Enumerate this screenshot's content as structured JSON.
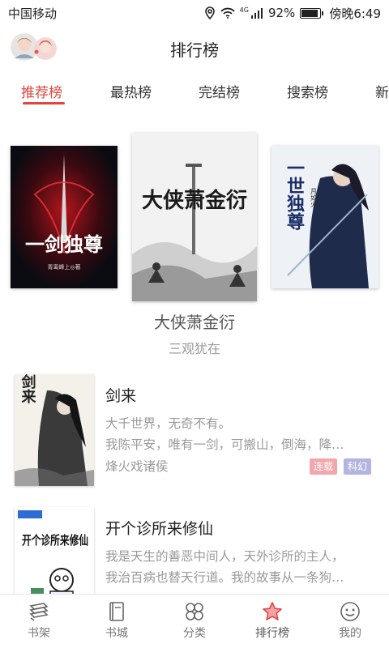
{
  "status_bar": {
    "carrier": "中国移动",
    "network": "4G",
    "battery": "92%",
    "battery_level": 0.92,
    "time": "傍晚6:49"
  },
  "header": {
    "title": "排行榜"
  },
  "tabs": [
    {
      "label": "推荐榜",
      "active": true
    },
    {
      "label": "最热榜",
      "active": false
    },
    {
      "label": "完结榜",
      "active": false
    },
    {
      "label": "搜索榜",
      "active": false
    },
    {
      "label": "新",
      "active": false
    }
  ],
  "featured": {
    "title": "大侠萧金衍",
    "author": "三观犹在",
    "covers": [
      {
        "name": "一剑独尊",
        "cover_text": "一剑独尊",
        "cover_author": "青鸾峰上◎著"
      },
      {
        "name": "大侠萧金衍",
        "cover_text": "大侠萧金衍"
      },
      {
        "name": "一世独尊",
        "cover_text": "一世独尊",
        "cover_author": "月如火"
      }
    ]
  },
  "books": [
    {
      "title": "剑来",
      "cover_text": "剑来",
      "desc_lines": [
        "大千世界，无奇不有。",
        "我陈平安，唯有一剑，可搬山，倒海，降…"
      ],
      "author": "烽火戏诸侯",
      "tags": [
        {
          "label": "连载",
          "color": "#f2a7ad"
        },
        {
          "label": "科幻",
          "color": "#b3b5e0"
        }
      ]
    },
    {
      "title": "开个诊所来修仙",
      "cover_text": "开个诊所来修仙",
      "desc_lines": [
        "我是天生的善恶中间人，天外诊所的主人，",
        "我治百病也替天行道。我的故事从一条狗…"
      ],
      "author": "",
      "tags": []
    }
  ],
  "bottom_nav": [
    {
      "label": "书架",
      "icon": "bookshelf-icon",
      "active": false
    },
    {
      "label": "书城",
      "icon": "book-icon",
      "active": false
    },
    {
      "label": "分类",
      "icon": "category-icon",
      "active": false
    },
    {
      "label": "排行榜",
      "icon": "star-icon",
      "active": true
    },
    {
      "label": "我的",
      "icon": "smiley-icon",
      "active": false
    }
  ],
  "colors": {
    "accent": "#e0463e",
    "text_gray": "#9a9a9a"
  }
}
